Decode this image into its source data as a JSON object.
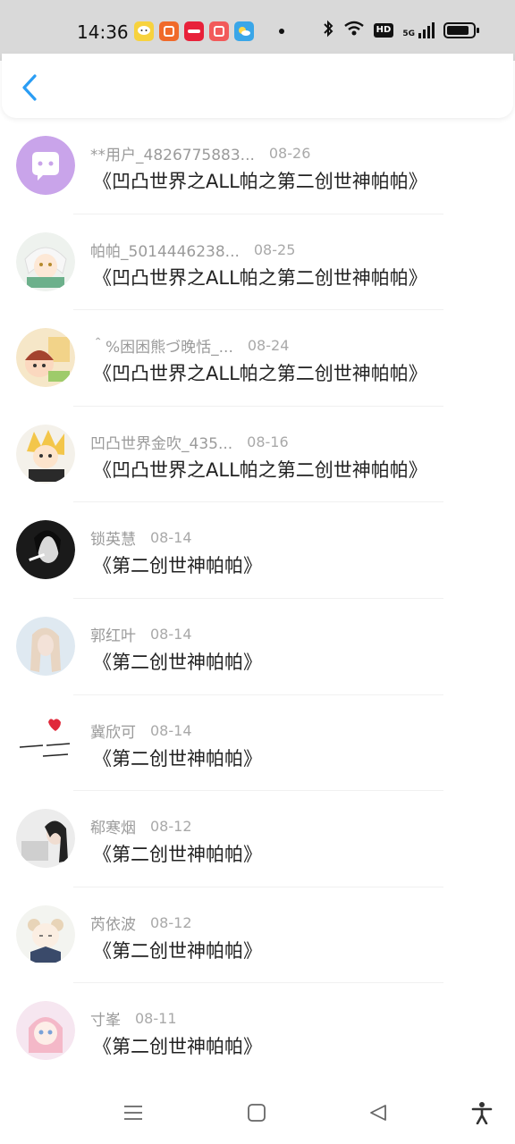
{
  "status_bar": {
    "time": "14:36",
    "hd": "HD",
    "network": "5G"
  },
  "header": {
    "back_icon": "chevron-left-icon",
    "accent_color": "#2a9df4"
  },
  "items": [
    {
      "name": "**用户_4826775883...",
      "date": "08-26",
      "title": "《凹凸世界之ALL帕之第二创世神帕帕》"
    },
    {
      "name": "帕帕_5014446238...",
      "date": "08-25",
      "title": "《凹凸世界之ALL帕之第二创世神帕帕》"
    },
    {
      "name": "＾%困困熊づ晚恬_...",
      "date": "08-24",
      "title": "《凹凸世界之ALL帕之第二创世神帕帕》"
    },
    {
      "name": "凹凸世界金吹_435...",
      "date": "08-16",
      "title": "《凹凸世界之ALL帕之第二创世神帕帕》"
    },
    {
      "name": "锁英慧",
      "date": "08-14",
      "title": "《第二创世神帕帕》"
    },
    {
      "name": "郭红叶",
      "date": "08-14",
      "title": "《第二创世神帕帕》"
    },
    {
      "name": "冀欣可",
      "date": "08-14",
      "title": "《第二创世神帕帕》"
    },
    {
      "name": "郗寒烟",
      "date": "08-12",
      "title": "《第二创世神帕帕》"
    },
    {
      "name": "芮依波",
      "date": "08-12",
      "title": "《第二创世神帕帕》"
    },
    {
      "name": "寸峯",
      "date": "08-11",
      "title": "《第二创世神帕帕》"
    }
  ],
  "nav": [
    "menu-icon",
    "home-icon",
    "back-icon",
    "accessibility-icon"
  ]
}
